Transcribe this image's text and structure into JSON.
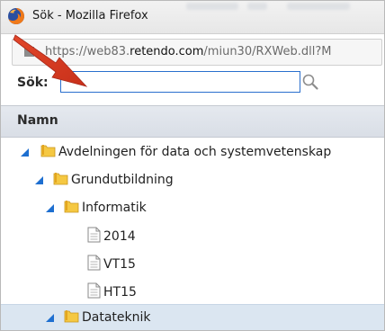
{
  "window": {
    "title": "Sök - Mozilla Firefox",
    "browser_icon": "firefox-icon"
  },
  "urlbar": {
    "prefix": "https://web83.",
    "domain": "retendo.com",
    "path": "/miun30/RXWeb.dll?M",
    "lock_icon": "lock-icon"
  },
  "search": {
    "label": "Sök:",
    "value": "",
    "icon": "magnifier-icon"
  },
  "table": {
    "column_header": "Namn"
  },
  "tree": {
    "nodes": [
      {
        "label": "Avdelningen för data och systemvetenskap",
        "type": "folder",
        "expanded": true
      },
      {
        "label": "Grundutbildning",
        "type": "folder",
        "expanded": true
      },
      {
        "label": "Informatik",
        "type": "folder",
        "expanded": true
      },
      {
        "label": "2014",
        "type": "document"
      },
      {
        "label": "VT15",
        "type": "document"
      },
      {
        "label": "HT15",
        "type": "document"
      },
      {
        "label": "Datateknik",
        "type": "folder",
        "expanded": true,
        "selected": true
      }
    ]
  },
  "annotation": {
    "arrow_color": "#d93a1e"
  }
}
